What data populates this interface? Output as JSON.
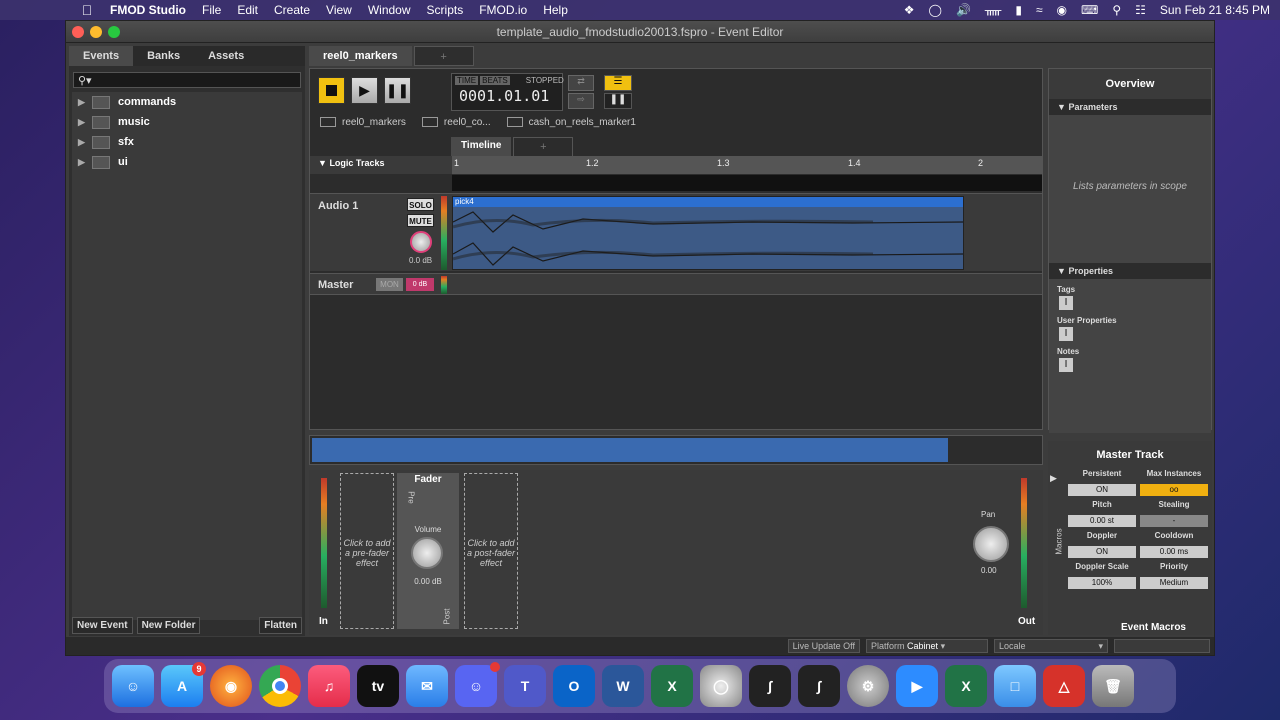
{
  "menubar": {
    "app_name": "FMOD Studio",
    "items": [
      "File",
      "Edit",
      "Create",
      "View",
      "Window",
      "Scripts",
      "FMOD.io",
      "Help"
    ],
    "clock": "Sun Feb 21  8:45 PM"
  },
  "window": {
    "title": "template_audio_fmodstudio20013.fspro - Event Editor"
  },
  "browser": {
    "tabs": [
      "Events",
      "Banks",
      "Assets"
    ],
    "search_placeholder": "",
    "folders": [
      "commands",
      "music",
      "sfx",
      "ui"
    ],
    "footer": {
      "new_event": "New Event",
      "new_folder": "New Folder",
      "flatten": "Flatten"
    }
  },
  "editor": {
    "tab": "reel0_markers",
    "transport": {
      "mode_time": "TIME",
      "mode_beats": "BEATS",
      "status": "STOPPED",
      "time": "0001.01.01"
    },
    "breadcrumbs": [
      "reel0_markers",
      "reel0_co...",
      "cash_on_reels_marker1"
    ],
    "timeline_tab": "Timeline",
    "logic_tracks_label": "Logic Tracks",
    "ruler_ticks": [
      "1",
      "1.2",
      "1.3",
      "1.4",
      "2"
    ],
    "track": {
      "name": "Audio 1",
      "solo": "SOLO",
      "mute": "MUTE",
      "volume": "0.0 dB",
      "region_name": "pick4"
    },
    "master": {
      "name": "Master",
      "mon": "MON",
      "fader": "0 dB"
    }
  },
  "overview": {
    "title": "Overview",
    "parameters_label": "Parameters",
    "parameters_hint": "Lists parameters in scope",
    "properties_label": "Properties",
    "tags": "Tags",
    "user_properties": "User Properties",
    "notes": "Notes"
  },
  "deck": {
    "pre_slot": "Click to add a pre-fader effect",
    "post_slot": "Click to add a post-fader effect",
    "fader_title": "Fader",
    "pre_label": "Pre",
    "post_label": "Post",
    "volume_label": "Volume",
    "volume_value": "0.00 dB",
    "in_label": "In",
    "out_label": "Out",
    "pan_label": "Pan",
    "pan_value": "0.00",
    "macros_side": "Macros"
  },
  "master_track": {
    "title": "Master Track",
    "persistent": "Persistent",
    "persistent_val": "ON",
    "max_instances": "Max Instances",
    "max_instances_val": "oo",
    "pitch": "Pitch",
    "pitch_val": "0.00 st",
    "stealing": "Stealing",
    "stealing_val": "-",
    "doppler": "Doppler",
    "doppler_val": "ON",
    "cooldown": "Cooldown",
    "cooldown_val": "0.00 ms",
    "doppler_scale": "Doppler Scale",
    "doppler_scale_val": "100%",
    "priority": "Priority",
    "priority_val": "Medium",
    "event_macros": "Event Macros"
  },
  "statusbar": {
    "live_update": "Live Update Off",
    "platform_label": "Platform",
    "platform_value": "Cabinet",
    "locale_label": "Locale"
  },
  "dock": {
    "app_store_badge": "9",
    "tv_label": "tv",
    "word_letter": "W",
    "excel_letter": "X",
    "teams_letter": "T",
    "outlook_letter": "O"
  }
}
